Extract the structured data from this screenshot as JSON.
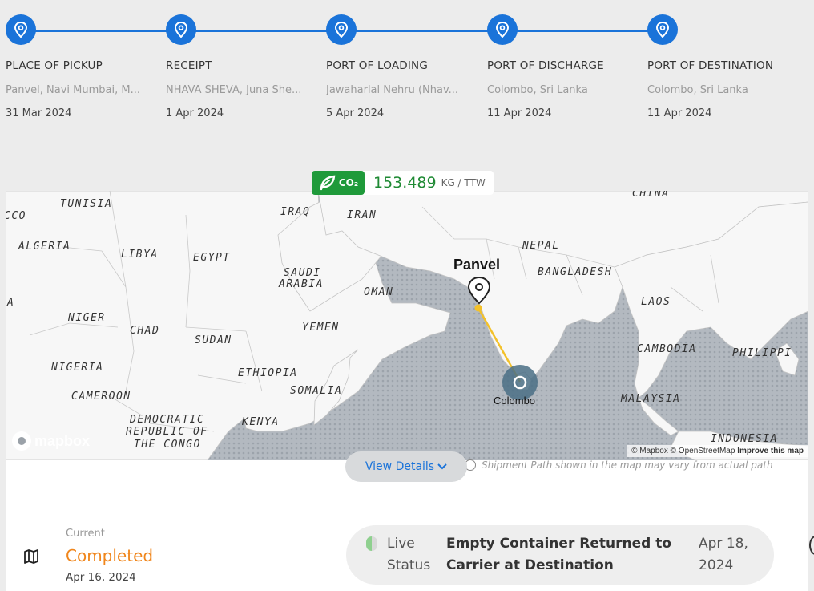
{
  "timeline": {
    "stops": [
      {
        "title": "PLACE OF PICKUP",
        "location": "Panvel, Navi Mumbai, M...",
        "date": "31 Mar 2024"
      },
      {
        "title": "RECEIPT",
        "location": "NHAVA SHEVA, Juna She...",
        "date": "1 Apr 2024"
      },
      {
        "title": "PORT OF LOADING",
        "location": "Jawaharlal Nehru (Nhav...",
        "date": "5 Apr 2024"
      },
      {
        "title": "PORT OF DISCHARGE",
        "location": "Colombo, Sri Lanka",
        "date": "11 Apr 2024"
      },
      {
        "title": "PORT OF DESTINATION",
        "location": "Colombo, Sri Lanka",
        "date": "11 Apr 2024"
      }
    ],
    "accent_color": "#1a73d9"
  },
  "emissions": {
    "badge_text": "CO₂",
    "value": "153.489",
    "unit": "KG / TTW",
    "badge_color": "#1f9a3a"
  },
  "map": {
    "origin_label": "Panvel",
    "destination_label": "Colombo",
    "route_color": "#f3c12a",
    "region_labels": [
      "TUNISIA",
      "CCO",
      "IRAQ",
      "IRAN",
      "CHINA",
      "ALGERIA",
      "LIBYA",
      "EGYPT",
      "NEPAL",
      "SAUDI",
      "ARABIA",
      "BANGLADESH",
      "OMAN",
      "A",
      "LAOS",
      "NIGER",
      "CHAD",
      "YEMEN",
      "SUDAN",
      "CAMBODIA",
      "PHILIPPI",
      "NIGERIA",
      "ETHIOPIA",
      "SOMALIA",
      "CAMEROON",
      "MALAYSIA",
      "DEMOCRATIC",
      "REPUBLIC OF",
      "THE CONGO",
      "KENYA",
      "INDONESIA"
    ],
    "logo_text": "mapbox",
    "attribution_mapbox": "© Mapbox",
    "attribution_osm": "© OpenStreetMap",
    "attribution_improve": "Improve this map"
  },
  "controls": {
    "view_details_label": "View Details",
    "disclaimer": "Shipment Path shown in the map may vary from actual path"
  },
  "current": {
    "label": "Current",
    "status": "Completed",
    "date": "Apr 16, 2024",
    "status_color": "#f0861c"
  },
  "live_status": {
    "label": "Live Status",
    "event": "Empty Container Returned to Carrier at Destination",
    "date": "Apr 18, 2024"
  }
}
